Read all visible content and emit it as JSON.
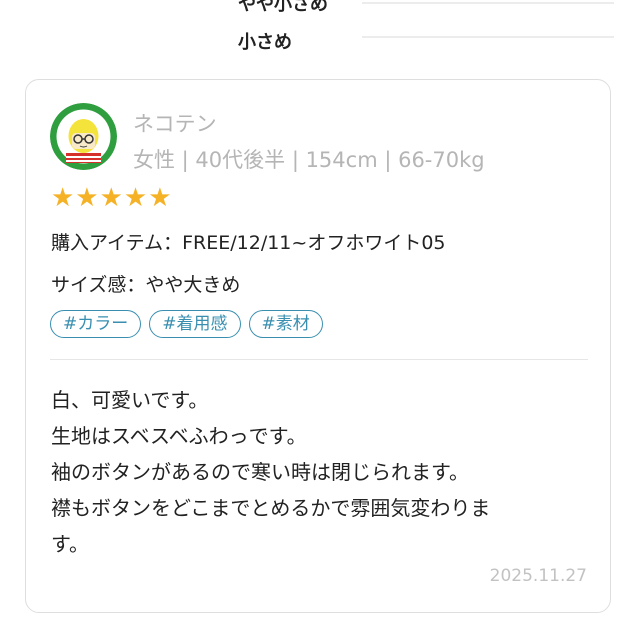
{
  "size_options": [
    "やや小さめ",
    "小さめ"
  ],
  "review": {
    "user_name": "ネコテン",
    "profile": "女性 | 40代後半 | 154cm | 66-70kg",
    "rating": 5,
    "stars": "★★★★★",
    "item": "購入アイテム：FREE/12/11~オフホワイト05",
    "fit": "サイズ感：やや大きめ",
    "tags": [
      "#カラー",
      "#着用感",
      "#素材"
    ],
    "body_lines": [
      "白、可愛いです。",
      "生地はスベスベふわっです。",
      "袖のボタンがあるので寒い時は閉じられます。",
      "襟もボタンをどこまでとめるかで雰囲気変わりま",
      "す。"
    ],
    "date": "2025.11.27"
  },
  "colors": {
    "star": "#f5b227",
    "tag": "#3a8fb0",
    "muted": "#b5b5b5",
    "avatar_ring": "#2e9e3e"
  }
}
